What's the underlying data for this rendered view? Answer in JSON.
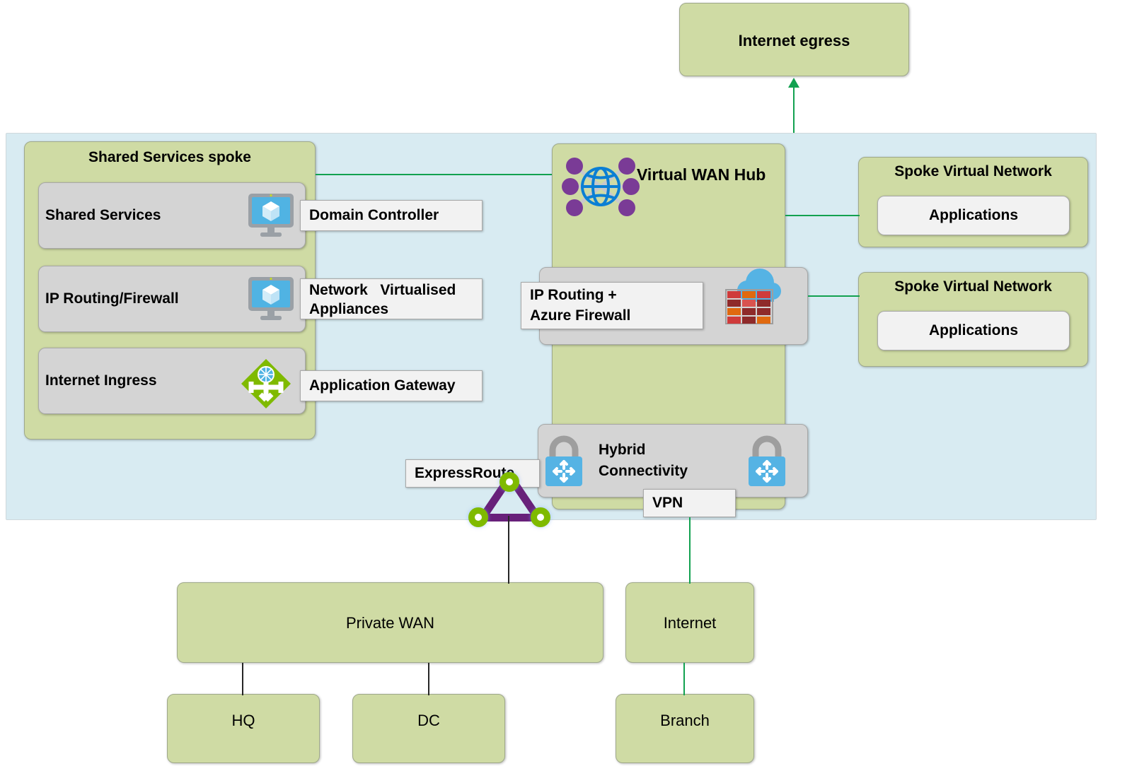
{
  "diagram": {
    "title_internet_egress": "Internet egress",
    "azure_panel": {
      "shared_services_spoke": {
        "title": "Shared Services spoke",
        "rows": [
          {
            "label": "Shared Services",
            "icon": "virtual-machine-icon",
            "callout": "Domain Controller"
          },
          {
            "label": "IP Routing/Firewall",
            "icon": "virtual-machine-icon",
            "callout": "Network   Virtualised\nAppliances"
          },
          {
            "label": "Internet Ingress",
            "icon": "application-gateway-icon",
            "callout": "Application Gateway"
          }
        ]
      },
      "virtual_wan_hub": {
        "title": "Virtual WAN Hub",
        "icon": "virtual-wan-hub-icon",
        "firewall_band": {
          "callout": "IP Routing +\nAzure Firewall",
          "icon": "azure-firewall-icon"
        },
        "hybrid_band": {
          "title": "Hybrid\nConnectivity",
          "left_icon": "vpn-gateway-icon",
          "right_icon": "vpn-gateway-icon",
          "vpn_callout": "VPN"
        }
      },
      "expressroute_callout": "ExpressRoute",
      "expressroute_icon": "expressroute-icon",
      "spokes": [
        {
          "title": "Spoke Virtual Network",
          "app": "Applications"
        },
        {
          "title": "Spoke Virtual Network",
          "app": "Applications"
        }
      ]
    },
    "on_premises": {
      "private_wan": "Private WAN",
      "internet": "Internet",
      "sites": [
        "HQ",
        "DC"
      ],
      "branch": "Branch"
    }
  },
  "colors": {
    "panel_blue": "#d8ebf2",
    "green_box": "#cfdba4",
    "grey_box": "#d4d4d4",
    "white_box": "#f2f2f2",
    "connector_green": "#12a150",
    "connector_black": "#262626",
    "expressroute_purple": "#68217a",
    "expressroute_node_green": "#7fba00",
    "azure_blue": "#0078d4"
  }
}
